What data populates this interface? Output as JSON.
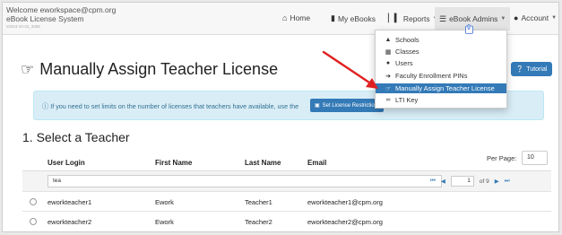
{
  "header": {
    "welcome": "Welcome eworkspace@cpm.org",
    "system": "eBook License System",
    "version": "v2024-10-22_3366",
    "nav": [
      {
        "label": "Home",
        "icon": "home-icon"
      },
      {
        "label": "My eBooks",
        "icon": "book-icon"
      },
      {
        "label": "Reports",
        "icon": "bar-chart-icon"
      },
      {
        "label": "eBook Admins",
        "icon": "list-icon"
      },
      {
        "label": "Account",
        "icon": "user-icon"
      }
    ]
  },
  "admin_menu": {
    "items": [
      {
        "label": "Schools",
        "icon": "graduation-cap-icon"
      },
      {
        "label": "Classes",
        "icon": "calendar-icon"
      },
      {
        "label": "Users",
        "icon": "user-icon"
      },
      {
        "label": "Faculty Enrollment PINs",
        "icon": "sign-in-icon"
      },
      {
        "label": "Manually Assign Teacher License",
        "icon": "hand-pointer-icon"
      },
      {
        "label": "LTI Key",
        "icon": "link-icon"
      }
    ],
    "highlighted_index": 4
  },
  "page": {
    "title": "Manually Assign Teacher License",
    "tutorial_label": "Tutorial",
    "info_text": "If you need to set limits on the number of licenses that teachers have available, use the",
    "info_button": "Set License Restrictions",
    "section_heading": "1. Select a Teacher",
    "per_page_label": "Per Page:",
    "per_page_value": "10"
  },
  "table": {
    "columns": [
      "User Login",
      "First Name",
      "Last Name",
      "Email"
    ],
    "filter_value": "tea",
    "pager": {
      "page": "1",
      "of_pages": "of 9"
    },
    "rows": [
      {
        "login": "eworkteacher1",
        "first": "Ework",
        "last": "Teacher1",
        "email": "eworkteacher1@cpm.org"
      },
      {
        "login": "eworkteacher2",
        "first": "Ework",
        "last": "Teacher2",
        "email": "eworkteacher2@cpm.org"
      }
    ]
  },
  "colors": {
    "primary": "#337ab7",
    "info_bg": "#d9edf7",
    "info_text": "#31708f",
    "arrow": "#e02020"
  }
}
